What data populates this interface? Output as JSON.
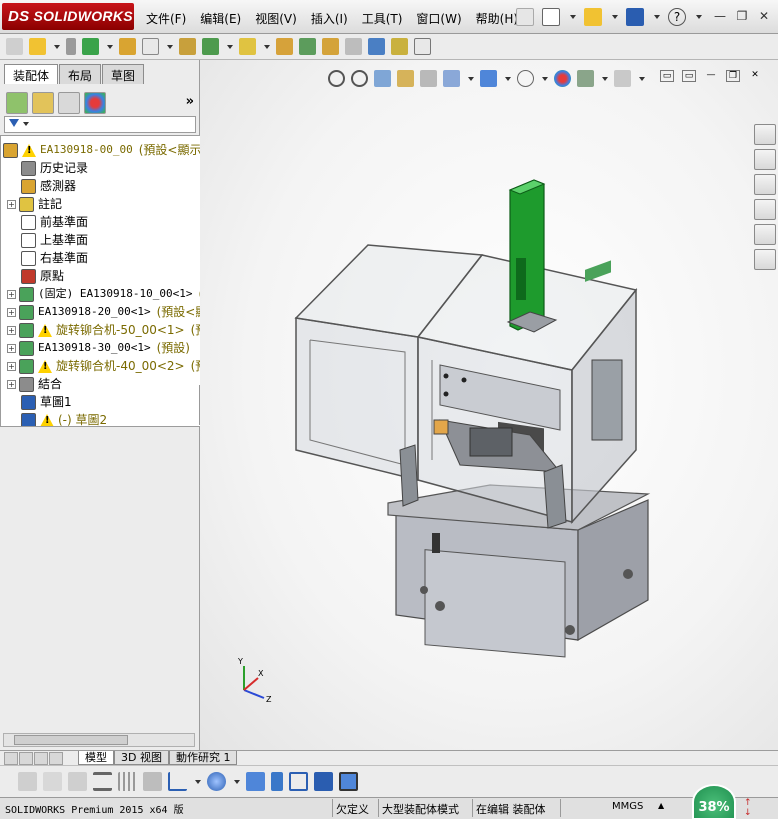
{
  "app": {
    "brand": "SOLIDWORKS",
    "brand_mark": "DS"
  },
  "menu": [
    "文件(F)",
    "编辑(E)",
    "视图(V)",
    "插入(I)",
    "工具(T)",
    "窗口(W)",
    "帮助(H)"
  ],
  "window_controls": {
    "minimize": "—",
    "restore": "❐",
    "close": "✕"
  },
  "left_panel": {
    "tabs": [
      "装配体",
      "布局",
      "草图"
    ],
    "active_tab": "装配体",
    "more": "»",
    "tree": [
      {
        "label": "EA130918-00_00",
        "suffix": "(預設<顯示",
        "style": "olive",
        "warn": true,
        "expand": "",
        "icon": "assembly-icon"
      },
      {
        "label": "历史记录",
        "style": "normal",
        "warn": false,
        "expand": "",
        "icon": "history-icon"
      },
      {
        "label": "感測器",
        "style": "normal",
        "warn": false,
        "expand": "",
        "icon": "sensor-icon"
      },
      {
        "label": "註記",
        "style": "normal",
        "warn": false,
        "expand": "+",
        "icon": "annotation-icon"
      },
      {
        "label": "前基準面",
        "style": "normal",
        "warn": false,
        "expand": "",
        "icon": "plane-icon"
      },
      {
        "label": "上基準面",
        "style": "normal",
        "warn": false,
        "expand": "",
        "icon": "plane-icon"
      },
      {
        "label": "右基準面",
        "style": "normal",
        "warn": false,
        "expand": "",
        "icon": "plane-icon"
      },
      {
        "label": "原點",
        "style": "normal",
        "warn": false,
        "expand": "",
        "icon": "origin-icon"
      },
      {
        "label": "(固定) EA130918-10_00<1>",
        "suffix": "(",
        "style": "normal",
        "warn": false,
        "expand": "+",
        "icon": "subassembly-icon"
      },
      {
        "label": "EA130918-20_00<1>",
        "suffix": "(預設<顯",
        "style": "normal",
        "warn": false,
        "expand": "+",
        "icon": "subassembly-icon"
      },
      {
        "label": "旋转铆合机-50_00<1>",
        "suffix": "(預",
        "style": "olive",
        "warn": true,
        "expand": "+",
        "icon": "subassembly-icon"
      },
      {
        "label": "EA130918-30_00<1>",
        "suffix": "(預設)",
        "style": "normal",
        "warn": false,
        "expand": "+",
        "icon": "subassembly-icon"
      },
      {
        "label": "旋转铆合机-40_00<2>",
        "suffix": "(預",
        "style": "olive",
        "warn": true,
        "expand": "+",
        "icon": "subassembly-icon"
      },
      {
        "label": "結合",
        "style": "normal",
        "warn": false,
        "expand": "+",
        "icon": "mates-icon"
      },
      {
        "label": "草圖1",
        "style": "normal",
        "warn": false,
        "expand": "",
        "icon": "sketch-icon"
      },
      {
        "label": "(-) 草圖2",
        "style": "olive",
        "warn": true,
        "expand": "",
        "icon": "sketch-icon"
      }
    ]
  },
  "bottom_tabs": [
    "模型",
    "3D 视图",
    "動作研究 1"
  ],
  "active_bottom_tab": "模型",
  "status": {
    "product": "SOLIDWORKS Premium 2015 x64 版",
    "definition": "欠定义",
    "mode": "大型装配体模式",
    "editing": "在编辑 装配体",
    "units": "MMGS",
    "performance": "38%"
  },
  "colors": {
    "brand_red": "#b5121b",
    "machine_green": "#1e9b2d",
    "machine_frame": "#6e6e6e",
    "warning_yellow": "#ffd200",
    "tree_olive": "#7a6a00"
  }
}
